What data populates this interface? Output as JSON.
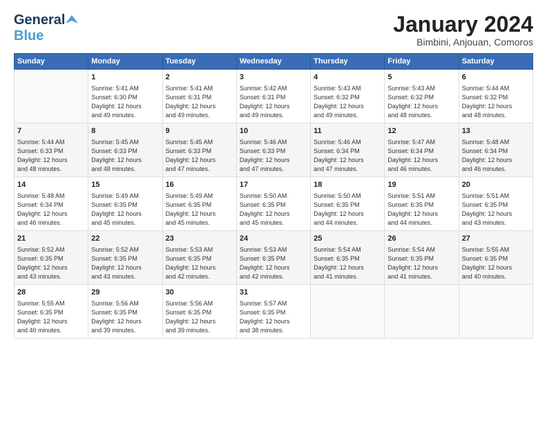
{
  "header": {
    "logo_line1": "General",
    "logo_line2": "Blue",
    "month": "January 2024",
    "location": "Bimbini, Anjouan, Comoros"
  },
  "days_of_week": [
    "Sunday",
    "Monday",
    "Tuesday",
    "Wednesday",
    "Thursday",
    "Friday",
    "Saturday"
  ],
  "weeks": [
    [
      {
        "num": "",
        "info": ""
      },
      {
        "num": "1",
        "info": "Sunrise: 5:41 AM\nSunset: 6:30 PM\nDaylight: 12 hours\nand 49 minutes."
      },
      {
        "num": "2",
        "info": "Sunrise: 5:41 AM\nSunset: 6:31 PM\nDaylight: 12 hours\nand 49 minutes."
      },
      {
        "num": "3",
        "info": "Sunrise: 5:42 AM\nSunset: 6:31 PM\nDaylight: 12 hours\nand 49 minutes."
      },
      {
        "num": "4",
        "info": "Sunrise: 5:43 AM\nSunset: 6:32 PM\nDaylight: 12 hours\nand 49 minutes."
      },
      {
        "num": "5",
        "info": "Sunrise: 5:43 AM\nSunset: 6:32 PM\nDaylight: 12 hours\nand 48 minutes."
      },
      {
        "num": "6",
        "info": "Sunrise: 5:44 AM\nSunset: 6:32 PM\nDaylight: 12 hours\nand 48 minutes."
      }
    ],
    [
      {
        "num": "7",
        "info": "Sunrise: 5:44 AM\nSunset: 6:33 PM\nDaylight: 12 hours\nand 48 minutes."
      },
      {
        "num": "8",
        "info": "Sunrise: 5:45 AM\nSunset: 6:33 PM\nDaylight: 12 hours\nand 48 minutes."
      },
      {
        "num": "9",
        "info": "Sunrise: 5:45 AM\nSunset: 6:33 PM\nDaylight: 12 hours\nand 47 minutes."
      },
      {
        "num": "10",
        "info": "Sunrise: 5:46 AM\nSunset: 6:33 PM\nDaylight: 12 hours\nand 47 minutes."
      },
      {
        "num": "11",
        "info": "Sunrise: 5:46 AM\nSunset: 6:34 PM\nDaylight: 12 hours\nand 47 minutes."
      },
      {
        "num": "12",
        "info": "Sunrise: 5:47 AM\nSunset: 6:34 PM\nDaylight: 12 hours\nand 46 minutes."
      },
      {
        "num": "13",
        "info": "Sunrise: 5:48 AM\nSunset: 6:34 PM\nDaylight: 12 hours\nand 46 minutes."
      }
    ],
    [
      {
        "num": "14",
        "info": "Sunrise: 5:48 AM\nSunset: 6:34 PM\nDaylight: 12 hours\nand 46 minutes."
      },
      {
        "num": "15",
        "info": "Sunrise: 5:49 AM\nSunset: 6:35 PM\nDaylight: 12 hours\nand 45 minutes."
      },
      {
        "num": "16",
        "info": "Sunrise: 5:49 AM\nSunset: 6:35 PM\nDaylight: 12 hours\nand 45 minutes."
      },
      {
        "num": "17",
        "info": "Sunrise: 5:50 AM\nSunset: 6:35 PM\nDaylight: 12 hours\nand 45 minutes."
      },
      {
        "num": "18",
        "info": "Sunrise: 5:50 AM\nSunset: 6:35 PM\nDaylight: 12 hours\nand 44 minutes."
      },
      {
        "num": "19",
        "info": "Sunrise: 5:51 AM\nSunset: 6:35 PM\nDaylight: 12 hours\nand 44 minutes."
      },
      {
        "num": "20",
        "info": "Sunrise: 5:51 AM\nSunset: 6:35 PM\nDaylight: 12 hours\nand 43 minutes."
      }
    ],
    [
      {
        "num": "21",
        "info": "Sunrise: 5:52 AM\nSunset: 6:35 PM\nDaylight: 12 hours\nand 43 minutes."
      },
      {
        "num": "22",
        "info": "Sunrise: 5:52 AM\nSunset: 6:35 PM\nDaylight: 12 hours\nand 43 minutes."
      },
      {
        "num": "23",
        "info": "Sunrise: 5:53 AM\nSunset: 6:35 PM\nDaylight: 12 hours\nand 42 minutes."
      },
      {
        "num": "24",
        "info": "Sunrise: 5:53 AM\nSunset: 6:35 PM\nDaylight: 12 hours\nand 42 minutes."
      },
      {
        "num": "25",
        "info": "Sunrise: 5:54 AM\nSunset: 6:35 PM\nDaylight: 12 hours\nand 41 minutes."
      },
      {
        "num": "26",
        "info": "Sunrise: 5:54 AM\nSunset: 6:35 PM\nDaylight: 12 hours\nand 41 minutes."
      },
      {
        "num": "27",
        "info": "Sunrise: 5:55 AM\nSunset: 6:35 PM\nDaylight: 12 hours\nand 40 minutes."
      }
    ],
    [
      {
        "num": "28",
        "info": "Sunrise: 5:55 AM\nSunset: 6:35 PM\nDaylight: 12 hours\nand 40 minutes."
      },
      {
        "num": "29",
        "info": "Sunrise: 5:56 AM\nSunset: 6:35 PM\nDaylight: 12 hours\nand 39 minutes."
      },
      {
        "num": "30",
        "info": "Sunrise: 5:56 AM\nSunset: 6:35 PM\nDaylight: 12 hours\nand 39 minutes."
      },
      {
        "num": "31",
        "info": "Sunrise: 5:57 AM\nSunset: 6:35 PM\nDaylight: 12 hours\nand 38 minutes."
      },
      {
        "num": "",
        "info": ""
      },
      {
        "num": "",
        "info": ""
      },
      {
        "num": "",
        "info": ""
      }
    ]
  ]
}
